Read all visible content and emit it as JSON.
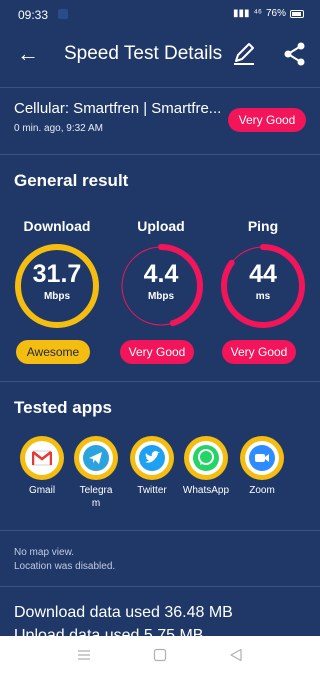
{
  "status": {
    "time": "09:33",
    "network": "⁴⁶",
    "battery": "76%"
  },
  "appbar": {
    "title": "Speed Test Details"
  },
  "connection": {
    "name": "Cellular: Smartfren | Smartfre...",
    "time": "0 min. ago, 9:32 AM",
    "rating": "Very Good"
  },
  "general": {
    "title": "General result",
    "download": {
      "label": "Download",
      "value": "31.7",
      "unit": "Mbps",
      "rating": "Awesome",
      "fill": 1.0,
      "color": "#f5bd0f"
    },
    "upload": {
      "label": "Upload",
      "value": "4.4",
      "unit": "Mbps",
      "rating": "Very Good",
      "fill": 0.45,
      "color": "#f2155a"
    },
    "ping": {
      "label": "Ping",
      "value": "44",
      "unit": "ms",
      "rating": "Very Good",
      "fill": 0.85,
      "color": "#f2155a"
    }
  },
  "apps": {
    "title": "Tested apps",
    "items": [
      {
        "name": "Gmail",
        "icon": "gmail-icon"
      },
      {
        "name": "Telegram",
        "icon": "telegram-icon"
      },
      {
        "name": "Twitter",
        "icon": "twitter-icon"
      },
      {
        "name": "WhatsApp",
        "icon": "whatsapp-icon"
      },
      {
        "name": "Zoom",
        "icon": "zoom-icon"
      }
    ]
  },
  "map": {
    "line1": "No map view.",
    "line2": "Location was disabled."
  },
  "usage": {
    "download": "Download data used  36.48 MB",
    "upload": "Upload data used  5.75 MB"
  },
  "colors": {
    "background": "#1f3868",
    "accent_red": "#f2155a",
    "accent_yellow": "#f5bd0f",
    "divider": "#3a5281"
  }
}
